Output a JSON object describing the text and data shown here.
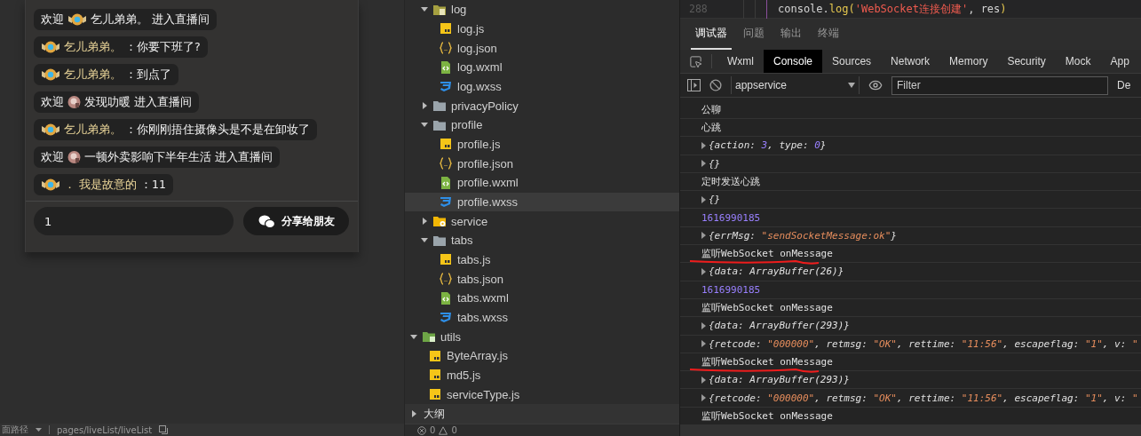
{
  "simulator": {
    "messages": [
      {
        "kind": "welcome",
        "prefix": "欢迎",
        "badge": {
          "kind": "gold"
        },
        "name": "乞儿弟弟。",
        "suffix": "进入直播间"
      },
      {
        "kind": "chat",
        "badge": {
          "kind": "gold"
        },
        "name": "乞儿弟弟。",
        "text": "：你要下班了?"
      },
      {
        "kind": "chat",
        "badge": {
          "kind": "gold"
        },
        "name": "乞儿弟弟。",
        "text": "：到点了"
      },
      {
        "kind": "welcome",
        "prefix": "欢迎",
        "badge": {
          "kind": "rose"
        },
        "name": "发现叻暖",
        "suffix": "进入直播间"
      },
      {
        "kind": "chat",
        "badge": {
          "kind": "gold"
        },
        "name": "乞儿弟弟。",
        "text": "：你刚刚捂住摄像头是不是在卸妆了"
      },
      {
        "kind": "welcome",
        "prefix": "欢迎",
        "badge": {
          "kind": "rose"
        },
        "name": "一顿外卖影响下半年生活",
        "suffix": "进入直播间"
      },
      {
        "kind": "chat",
        "badge": {
          "kind": "gold"
        },
        "name": "． 我是故意的",
        "text": "：11"
      }
    ],
    "message_input": {
      "value": "1"
    },
    "share_button": {
      "label": "分享给朋友"
    }
  },
  "status_bar": {
    "path_label": "面路径",
    "path": "pages/liveList/liveList"
  },
  "file_tree": {
    "items": [
      {
        "children": [
          {
            "kind": "log-folder",
            "label": "log",
            "expanded": true,
            "selected": false,
            "children": [
              {
                "kind": "js",
                "label": "log.js",
                "selected": false
              },
              {
                "kind": "json",
                "label": "log.json",
                "selected": false
              },
              {
                "kind": "wxml",
                "label": "log.wxml",
                "selected": false
              },
              {
                "kind": "wxss",
                "label": "log.wxss",
                "selected": false
              }
            ]
          },
          {
            "kind": "folder",
            "label": "privacyPolicy",
            "expanded": false,
            "selected": false
          },
          {
            "kind": "folder",
            "label": "profile",
            "expanded": true,
            "selected": false,
            "children": [
              {
                "kind": "js",
                "label": "profile.js",
                "selected": false
              },
              {
                "kind": "json",
                "label": "profile.json",
                "selected": false
              },
              {
                "kind": "wxml",
                "label": "profile.wxml",
                "selected": false
              },
              {
                "kind": "wxss",
                "label": "profile.wxss",
                "selected": true
              }
            ]
          },
          {
            "kind": "service-folder",
            "label": "service",
            "expanded": false,
            "selected": false
          },
          {
            "kind": "folder",
            "label": "tabs",
            "expanded": true,
            "selected": false,
            "children": [
              {
                "kind": "js",
                "label": "tabs.js",
                "selected": false
              },
              {
                "kind": "json",
                "label": "tabs.json",
                "selected": false
              },
              {
                "kind": "wxml",
                "label": "tabs.wxml",
                "selected": false
              },
              {
                "kind": "wxss",
                "label": "tabs.wxss",
                "selected": false
              }
            ]
          }
        ]
      },
      {
        "kind": "utils-folder",
        "label": "utils",
        "expanded": true,
        "selected": false,
        "children": [
          {
            "kind": "js",
            "label": "ByteArray.js",
            "selected": false
          },
          {
            "kind": "js",
            "label": "md5.js",
            "selected": false
          },
          {
            "kind": "js",
            "label": "serviceType.js",
            "selected": false
          }
        ]
      }
    ]
  },
  "outline": {
    "label": "大纲",
    "expanded": false
  },
  "problems": {
    "errors": "0",
    "warnings": "0"
  },
  "code_line": {
    "line_number": "288",
    "segments": [
      {
        "kind": "plain",
        "text": "console."
      },
      {
        "kind": "func",
        "text": "log("
      },
      {
        "kind": "string",
        "text": "'WebSocket连接创建'"
      },
      {
        "kind": "plain",
        "text": ", res"
      },
      {
        "kind": "func",
        "text": ")"
      }
    ]
  },
  "panel_tabs": [
    {
      "label": "调试器",
      "selected": true
    },
    {
      "label": "问题",
      "selected": false
    },
    {
      "label": "输出",
      "selected": false
    },
    {
      "label": "终端",
      "selected": false
    }
  ],
  "tool_tabs": [
    {
      "label": "Wxml",
      "selected": false
    },
    {
      "label": "Console",
      "selected": true
    },
    {
      "label": "Sources",
      "selected": false
    },
    {
      "label": "Network",
      "selected": false
    },
    {
      "label": "Memory",
      "selected": false
    },
    {
      "label": "Security",
      "selected": false
    },
    {
      "label": "Mock",
      "selected": false
    },
    {
      "label": "App",
      "selected": false
    }
  ],
  "console_toolbar": {
    "context": "appservice",
    "filter_placeholder": "Filter",
    "level_label": "De"
  },
  "logs": [
    {
      "kind": "text",
      "underlined": false,
      "segments": [
        {
          "kind": "plain",
          "text": "公聊"
        }
      ]
    },
    {
      "kind": "text",
      "underlined": false,
      "segments": [
        {
          "kind": "plain",
          "text": "心跳"
        }
      ]
    },
    {
      "kind": "object",
      "underlined": false,
      "segments": [
        {
          "kind": "plain",
          "text": "{action: "
        },
        {
          "kind": "number",
          "text": "3"
        },
        {
          "kind": "plain",
          "text": ", type: "
        },
        {
          "kind": "number",
          "text": "0"
        },
        {
          "kind": "plain",
          "text": "}"
        }
      ]
    },
    {
      "kind": "object",
      "underlined": false,
      "segments": [
        {
          "kind": "plain",
          "text": "{}"
        }
      ]
    },
    {
      "kind": "text",
      "underlined": false,
      "segments": [
        {
          "kind": "plain",
          "text": "定时发送心跳"
        }
      ]
    },
    {
      "kind": "object",
      "underlined": false,
      "segments": [
        {
          "kind": "plain",
          "text": "{}"
        }
      ]
    },
    {
      "kind": "text",
      "underlined": false,
      "segments": [
        {
          "kind": "number",
          "text": "1616990185"
        }
      ]
    },
    {
      "kind": "object",
      "underlined": false,
      "segments": [
        {
          "kind": "plain",
          "text": "{errMsg: "
        },
        {
          "kind": "string",
          "text": "\"sendSocketMessage:ok\""
        },
        {
          "kind": "plain",
          "text": "}"
        }
      ]
    },
    {
      "kind": "text",
      "underlined": true,
      "segments": [
        {
          "kind": "plain",
          "text": "监听WebSocket onMessage"
        }
      ]
    },
    {
      "kind": "object",
      "underlined": false,
      "segments": [
        {
          "kind": "plain",
          "text": "{data: ArrayBuffer(26)}"
        }
      ]
    },
    {
      "kind": "text",
      "underlined": false,
      "segments": [
        {
          "kind": "number",
          "text": "1616990185"
        }
      ]
    },
    {
      "kind": "text",
      "underlined": false,
      "segments": [
        {
          "kind": "plain",
          "text": "监听WebSocket onMessage"
        }
      ]
    },
    {
      "kind": "object",
      "underlined": false,
      "segments": [
        {
          "kind": "plain",
          "text": "{data: ArrayBuffer(293)}"
        }
      ]
    },
    {
      "kind": "object",
      "underlined": false,
      "segments": [
        {
          "kind": "plain",
          "text": "{retcode: "
        },
        {
          "kind": "string",
          "text": "\"000000\""
        },
        {
          "kind": "plain",
          "text": ", retmsg: "
        },
        {
          "kind": "string",
          "text": "\"OK\""
        },
        {
          "kind": "plain",
          "text": ", rettime: "
        },
        {
          "kind": "string",
          "text": "\"11:56\""
        },
        {
          "kind": "plain",
          "text": ", escapeflag: "
        },
        {
          "kind": "string",
          "text": "\"1\""
        },
        {
          "kind": "plain",
          "text": ", v: "
        },
        {
          "kind": "string",
          "text": "\""
        }
      ]
    },
    {
      "kind": "text",
      "underlined": true,
      "segments": [
        {
          "kind": "plain",
          "text": "监听WebSocket onMessage"
        }
      ]
    },
    {
      "kind": "object",
      "underlined": false,
      "segments": [
        {
          "kind": "plain",
          "text": "{data: ArrayBuffer(293)}"
        }
      ]
    },
    {
      "kind": "object",
      "underlined": false,
      "segments": [
        {
          "kind": "plain",
          "text": "{retcode: "
        },
        {
          "kind": "string",
          "text": "\"000000\""
        },
        {
          "kind": "plain",
          "text": ", retmsg: "
        },
        {
          "kind": "string",
          "text": "\"OK\""
        },
        {
          "kind": "plain",
          "text": ", rettime: "
        },
        {
          "kind": "string",
          "text": "\"11:56\""
        },
        {
          "kind": "plain",
          "text": ", escapeflag: "
        },
        {
          "kind": "string",
          "text": "\"1\""
        },
        {
          "kind": "plain",
          "text": ", v: "
        },
        {
          "kind": "string",
          "text": "\""
        }
      ]
    },
    {
      "kind": "text",
      "underlined": false,
      "segments": [
        {
          "kind": "plain",
          "text": "监听WebSocket onMessage"
        }
      ]
    }
  ]
}
